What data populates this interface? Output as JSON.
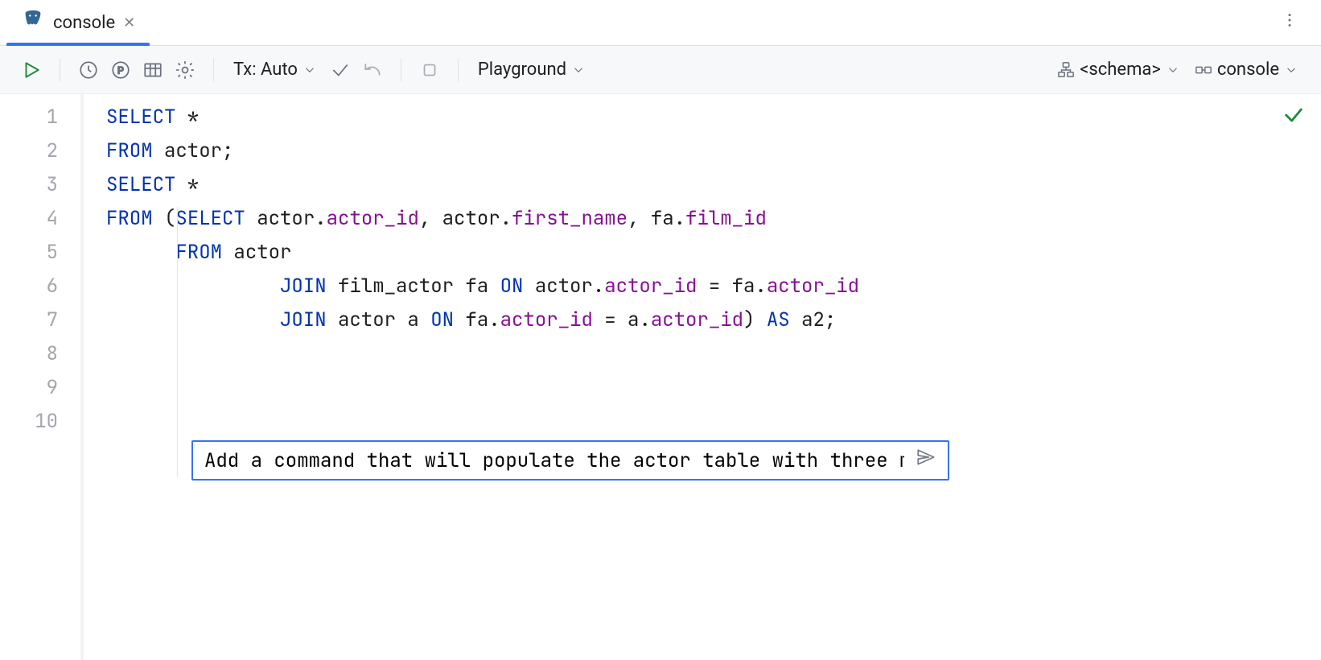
{
  "tab": {
    "label": "console"
  },
  "toolbar": {
    "tx_label": "Tx: Auto",
    "playground_label": "Playground",
    "schema_label": "<schema>",
    "session_label": "console"
  },
  "editor": {
    "lines": [
      "1",
      "2",
      "3",
      "4",
      "5",
      "6",
      "7",
      "8",
      "9",
      "10"
    ],
    "code": {
      "l1_kw": "SELECT",
      "l1_star": " *",
      "l2_kw": "FROM",
      "l2_rest": " actor;",
      "l4_kw": "SELECT",
      "l4_star": " *",
      "l5_kw": "FROM",
      "l5_paren": " (",
      "l5_kw2": "SELECT",
      "l5_rest1": " actor.",
      "l5_col1": "actor_id",
      "l5_c1": ", actor.",
      "l5_col2": "first_name",
      "l5_c2": ", fa.",
      "l5_col3": "film_id",
      "l6_pad": "      ",
      "l6_kw": "FROM",
      "l6_rest": " actor",
      "l7_pad": "               ",
      "l7_kw": "JOIN",
      "l7_rest1": " film_actor fa ",
      "l7_kw2": "ON",
      "l7_rest2": " actor.",
      "l7_col1": "actor_id",
      "l7_eq": " = fa.",
      "l7_col2": "actor_id",
      "l8_pad": "               ",
      "l8_kw": "JOIN",
      "l8_rest1": " actor a ",
      "l8_kw2": "ON",
      "l8_rest2": " fa.",
      "l8_col1": "actor_id",
      "l8_eq": " = a.",
      "l8_col2": "actor_id",
      "l8_end": ") ",
      "l8_kw3": "AS",
      "l8_alias": " a2;"
    }
  },
  "prompt": {
    "value": "Add a command that will populate the actor table with three more rows"
  }
}
